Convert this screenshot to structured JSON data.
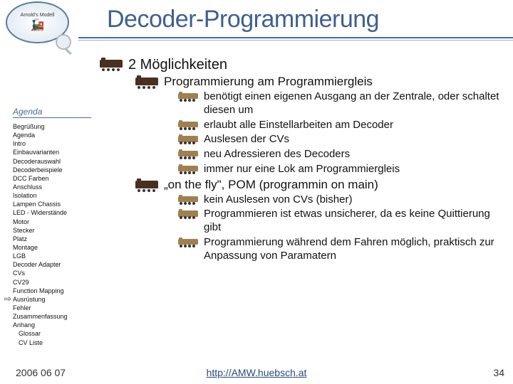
{
  "title": "Decoder-Programmierung",
  "logo": {
    "top": "Arnold's Modell",
    "sub": "AMW"
  },
  "h1": "2 Möglichkeiten",
  "sec1": {
    "title": "Programmierung am Programmiergleis",
    "items": [
      "benötigt einen eigenen Ausgang an der Zentrale, oder schaltet diesen um",
      "erlaubt alle Einstellarbeiten am Decoder",
      "Auslesen der CVs",
      "neu Adressieren des Decoders",
      "immer nur eine Lok am Programmiergleis"
    ]
  },
  "sec2": {
    "title": "„on the fly\", POM (programmin on main)",
    "items": [
      "kein Auslesen von CVs (bisher)",
      "Programmieren ist etwas unsicherer, da es keine Quittierung gibt",
      "Programmierung während dem Fahren möglich, praktisch zur Anpassung von Paramatern"
    ]
  },
  "sidebar": {
    "header": "Agenda",
    "items": [
      "Begrüßung",
      "Agenda",
      "Intro",
      "Einbauvarianten",
      "Decoderauswahl",
      "Decoderbeispiele",
      "DCC Farben",
      "Anschluss",
      "Isolation",
      "Lampen Chassis",
      "LED - Widerstände",
      "Motor",
      "Stecker",
      "Platz",
      "Montage",
      "LGB",
      "Decoder Adapter",
      "CVs",
      "CV29",
      "Function Mapping",
      "Ausrüstung",
      "Fehler",
      "Zusammenfassung",
      "Anhang"
    ],
    "indented": [
      "Glossar",
      "CV Liste"
    ],
    "current_index": 17
  },
  "footer": {
    "date": "2006 06 07",
    "url": "http://AMW.huebsch.at",
    "page": "34"
  }
}
